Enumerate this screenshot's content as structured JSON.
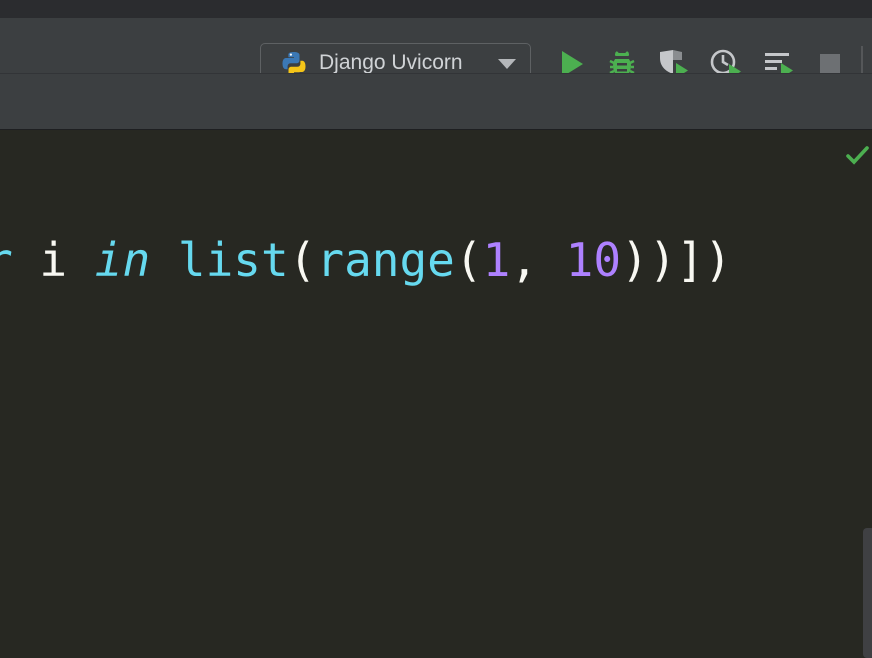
{
  "run_config": {
    "name": "Django Uvicorn",
    "icon": "python-icon"
  },
  "toolbar": {
    "buttons": [
      {
        "name": "run-button",
        "icon": "play-icon",
        "color": "#4caf50"
      },
      {
        "name": "debug-button",
        "icon": "bug-icon",
        "color": "#4caf50"
      },
      {
        "name": "run-with-coverage-button",
        "icon": "shield-play-icon"
      },
      {
        "name": "profile-button",
        "icon": "clock-play-icon"
      },
      {
        "name": "run-concurrency-button",
        "icon": "list-play-icon"
      },
      {
        "name": "stop-button",
        "icon": "stop-icon"
      }
    ]
  },
  "editor": {
    "code_tokens": [
      {
        "text": "r",
        "kind": "kw"
      },
      {
        "text": " i ",
        "kind": "plain"
      },
      {
        "text": "in",
        "kind": "kw"
      },
      {
        "text": " ",
        "kind": "plain"
      },
      {
        "text": "list",
        "kind": "fn"
      },
      {
        "text": "(",
        "kind": "plain"
      },
      {
        "text": "range",
        "kind": "fn"
      },
      {
        "text": "(",
        "kind": "plain"
      },
      {
        "text": "1",
        "kind": "num"
      },
      {
        "text": ", ",
        "kind": "plain"
      },
      {
        "text": "10",
        "kind": "num"
      },
      {
        "text": "))])",
        "kind": "plain"
      }
    ],
    "inspection_status": "check-icon"
  },
  "colors": {
    "editor_bg": "#272822",
    "toolbar_bg": "#3c3f41",
    "keyword": "#66d9ef",
    "number": "#ae81ff",
    "green": "#4caf50"
  }
}
